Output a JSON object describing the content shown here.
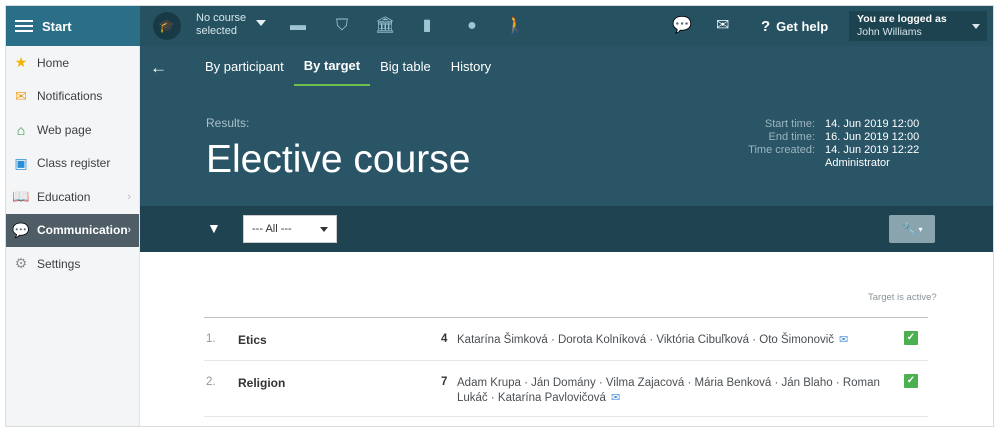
{
  "topbar": {
    "start_label": "Start",
    "course_select_line1": "No course",
    "course_select_line2": "selected",
    "help_label": "Get help",
    "login_line1": "You are logged as",
    "login_line2": "John Williams"
  },
  "sidebar": {
    "items": [
      {
        "label": "Home",
        "icon": "star-icon"
      },
      {
        "label": "Notifications",
        "icon": "envelope-icon"
      },
      {
        "label": "Web page",
        "icon": "house-icon"
      },
      {
        "label": "Class register",
        "icon": "register-icon"
      },
      {
        "label": "Education",
        "icon": "book-icon"
      },
      {
        "label": "Communication",
        "icon": "chat-icon"
      },
      {
        "label": "Settings",
        "icon": "gear-icon"
      }
    ]
  },
  "header": {
    "tabs": [
      "By participant",
      "By target",
      "Big table",
      "History"
    ],
    "active_tab": "By target",
    "results_label": "Results:",
    "title": "Elective course",
    "meta": [
      {
        "label": "Start time:",
        "value": "14. Jun 2019 12:00"
      },
      {
        "label": "End time:",
        "value": "16. Jun 2019 12:00"
      },
      {
        "label": "Time created:",
        "value": "14. Jun 2019 12:22"
      },
      {
        "label": "",
        "value": "Administrator"
      }
    ]
  },
  "filter": {
    "selected": "--- All ---"
  },
  "content": {
    "column_note": "Target is active?",
    "rows": [
      {
        "index": "1.",
        "name": "Etics",
        "count": "4",
        "participants": "Katarína Šimková · Dorota Kolníková · Viktória Cibuľková · Oto Šimonovič",
        "active": true
      },
      {
        "index": "2.",
        "name": "Religion",
        "count": "7",
        "participants": "Adam Krupa · Ján Domány · Vilma Zajacová · Mária Benková · Ján Blaho · Roman Lukáč · Katarína Pavlovičová",
        "active": true
      }
    ]
  },
  "colors": {
    "topbar": "#255160",
    "start": "#2a6f87",
    "header": "#2a5566",
    "filterbar": "#1f4351",
    "active_tab_underline": "#6fbf4a",
    "check": "#4caf50"
  }
}
